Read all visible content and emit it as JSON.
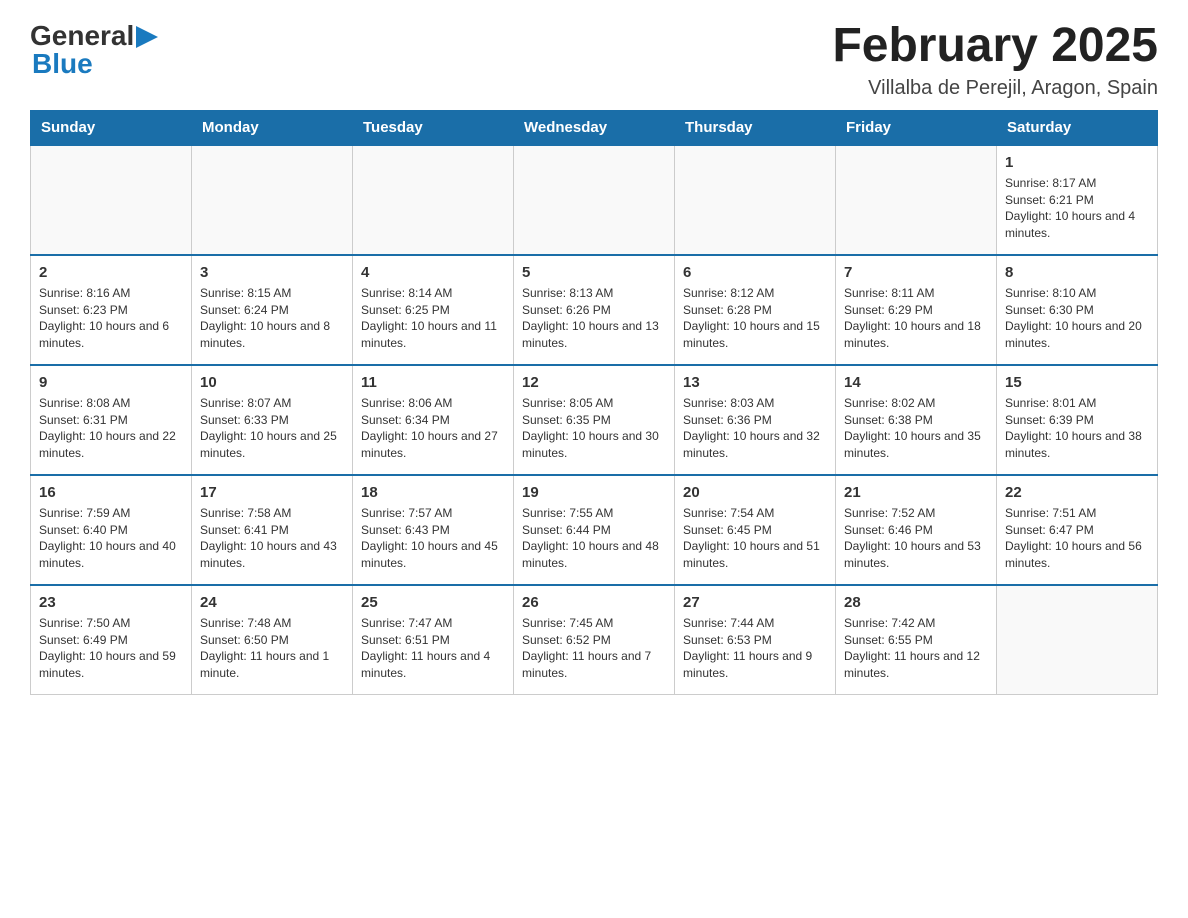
{
  "header": {
    "logo_general": "General",
    "logo_blue": "Blue",
    "month_title": "February 2025",
    "location": "Villalba de Perejil, Aragon, Spain"
  },
  "weekdays": [
    "Sunday",
    "Monday",
    "Tuesday",
    "Wednesday",
    "Thursday",
    "Friday",
    "Saturday"
  ],
  "weeks": [
    [
      {
        "day": "",
        "info": ""
      },
      {
        "day": "",
        "info": ""
      },
      {
        "day": "",
        "info": ""
      },
      {
        "day": "",
        "info": ""
      },
      {
        "day": "",
        "info": ""
      },
      {
        "day": "",
        "info": ""
      },
      {
        "day": "1",
        "info": "Sunrise: 8:17 AM\nSunset: 6:21 PM\nDaylight: 10 hours and 4 minutes."
      }
    ],
    [
      {
        "day": "2",
        "info": "Sunrise: 8:16 AM\nSunset: 6:23 PM\nDaylight: 10 hours and 6 minutes."
      },
      {
        "day": "3",
        "info": "Sunrise: 8:15 AM\nSunset: 6:24 PM\nDaylight: 10 hours and 8 minutes."
      },
      {
        "day": "4",
        "info": "Sunrise: 8:14 AM\nSunset: 6:25 PM\nDaylight: 10 hours and 11 minutes."
      },
      {
        "day": "5",
        "info": "Sunrise: 8:13 AM\nSunset: 6:26 PM\nDaylight: 10 hours and 13 minutes."
      },
      {
        "day": "6",
        "info": "Sunrise: 8:12 AM\nSunset: 6:28 PM\nDaylight: 10 hours and 15 minutes."
      },
      {
        "day": "7",
        "info": "Sunrise: 8:11 AM\nSunset: 6:29 PM\nDaylight: 10 hours and 18 minutes."
      },
      {
        "day": "8",
        "info": "Sunrise: 8:10 AM\nSunset: 6:30 PM\nDaylight: 10 hours and 20 minutes."
      }
    ],
    [
      {
        "day": "9",
        "info": "Sunrise: 8:08 AM\nSunset: 6:31 PM\nDaylight: 10 hours and 22 minutes."
      },
      {
        "day": "10",
        "info": "Sunrise: 8:07 AM\nSunset: 6:33 PM\nDaylight: 10 hours and 25 minutes."
      },
      {
        "day": "11",
        "info": "Sunrise: 8:06 AM\nSunset: 6:34 PM\nDaylight: 10 hours and 27 minutes."
      },
      {
        "day": "12",
        "info": "Sunrise: 8:05 AM\nSunset: 6:35 PM\nDaylight: 10 hours and 30 minutes."
      },
      {
        "day": "13",
        "info": "Sunrise: 8:03 AM\nSunset: 6:36 PM\nDaylight: 10 hours and 32 minutes."
      },
      {
        "day": "14",
        "info": "Sunrise: 8:02 AM\nSunset: 6:38 PM\nDaylight: 10 hours and 35 minutes."
      },
      {
        "day": "15",
        "info": "Sunrise: 8:01 AM\nSunset: 6:39 PM\nDaylight: 10 hours and 38 minutes."
      }
    ],
    [
      {
        "day": "16",
        "info": "Sunrise: 7:59 AM\nSunset: 6:40 PM\nDaylight: 10 hours and 40 minutes."
      },
      {
        "day": "17",
        "info": "Sunrise: 7:58 AM\nSunset: 6:41 PM\nDaylight: 10 hours and 43 minutes."
      },
      {
        "day": "18",
        "info": "Sunrise: 7:57 AM\nSunset: 6:43 PM\nDaylight: 10 hours and 45 minutes."
      },
      {
        "day": "19",
        "info": "Sunrise: 7:55 AM\nSunset: 6:44 PM\nDaylight: 10 hours and 48 minutes."
      },
      {
        "day": "20",
        "info": "Sunrise: 7:54 AM\nSunset: 6:45 PM\nDaylight: 10 hours and 51 minutes."
      },
      {
        "day": "21",
        "info": "Sunrise: 7:52 AM\nSunset: 6:46 PM\nDaylight: 10 hours and 53 minutes."
      },
      {
        "day": "22",
        "info": "Sunrise: 7:51 AM\nSunset: 6:47 PM\nDaylight: 10 hours and 56 minutes."
      }
    ],
    [
      {
        "day": "23",
        "info": "Sunrise: 7:50 AM\nSunset: 6:49 PM\nDaylight: 10 hours and 59 minutes."
      },
      {
        "day": "24",
        "info": "Sunrise: 7:48 AM\nSunset: 6:50 PM\nDaylight: 11 hours and 1 minute."
      },
      {
        "day": "25",
        "info": "Sunrise: 7:47 AM\nSunset: 6:51 PM\nDaylight: 11 hours and 4 minutes."
      },
      {
        "day": "26",
        "info": "Sunrise: 7:45 AM\nSunset: 6:52 PM\nDaylight: 11 hours and 7 minutes."
      },
      {
        "day": "27",
        "info": "Sunrise: 7:44 AM\nSunset: 6:53 PM\nDaylight: 11 hours and 9 minutes."
      },
      {
        "day": "28",
        "info": "Sunrise: 7:42 AM\nSunset: 6:55 PM\nDaylight: 11 hours and 12 minutes."
      },
      {
        "day": "",
        "info": ""
      }
    ]
  ]
}
